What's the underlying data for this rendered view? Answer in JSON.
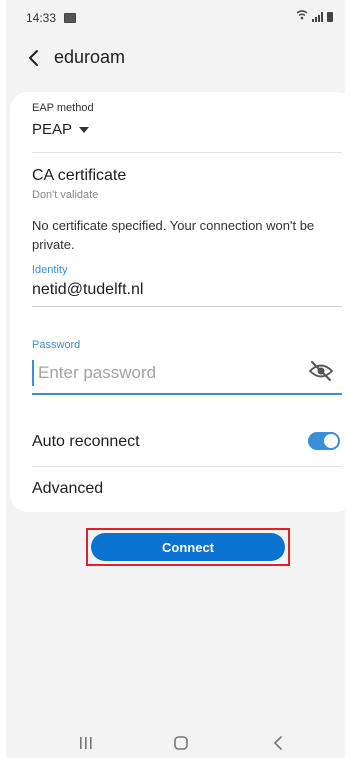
{
  "status_bar": {
    "time": "14:33",
    "gallery_icon": "gallery-icon",
    "wifi_icon": "wifi-calling-icon",
    "signal_icon": "signal-bars-icon",
    "battery_icon": "battery-icon"
  },
  "header": {
    "back_icon": "chevron-left-icon",
    "title": "eduroam"
  },
  "form": {
    "eap_method": {
      "label": "EAP method",
      "value": "PEAP"
    },
    "ca_certificate": {
      "title": "CA certificate",
      "value": "Don't validate"
    },
    "warning": "No certificate specified. Your connection won't be private.",
    "identity": {
      "label": "Identity",
      "value": "netid@tudelft.nl"
    },
    "password": {
      "label": "Password",
      "placeholder": "Enter password",
      "visibility_icon": "eye-off-icon"
    },
    "auto_reconnect": {
      "label": "Auto reconnect",
      "enabled": true
    },
    "advanced": {
      "label": "Advanced"
    }
  },
  "connect": {
    "label": "Connect"
  },
  "colors": {
    "accent": "#3b8ed8",
    "button": "#0a72d1",
    "highlight": "#e0202a",
    "background": "#f3f3f3"
  },
  "nav": {
    "recent_icon": "recent-apps-icon",
    "home_icon": "home-icon",
    "back_icon": "back-icon"
  }
}
